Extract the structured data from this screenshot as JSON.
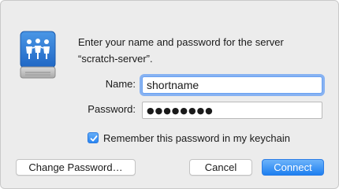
{
  "dialog": {
    "message_line1": "Enter your name and password for the server",
    "message_line2": "“scratch-server”."
  },
  "icon": {
    "name": "file-server-icon",
    "accent_color": "#2f7fd6"
  },
  "form": {
    "name_label": "Name:",
    "name_value": "shortname",
    "password_label": "Password:",
    "password_mask": "●●●●●●●●",
    "remember_label": "Remember this password in my keychain",
    "remember_checked": true
  },
  "buttons": {
    "change_password": "Change Password…",
    "cancel": "Cancel",
    "connect": "Connect"
  },
  "colors": {
    "primary_button": "#1e7ff0",
    "focus_ring": "#659ff4",
    "dialog_bg": "#ececec"
  }
}
